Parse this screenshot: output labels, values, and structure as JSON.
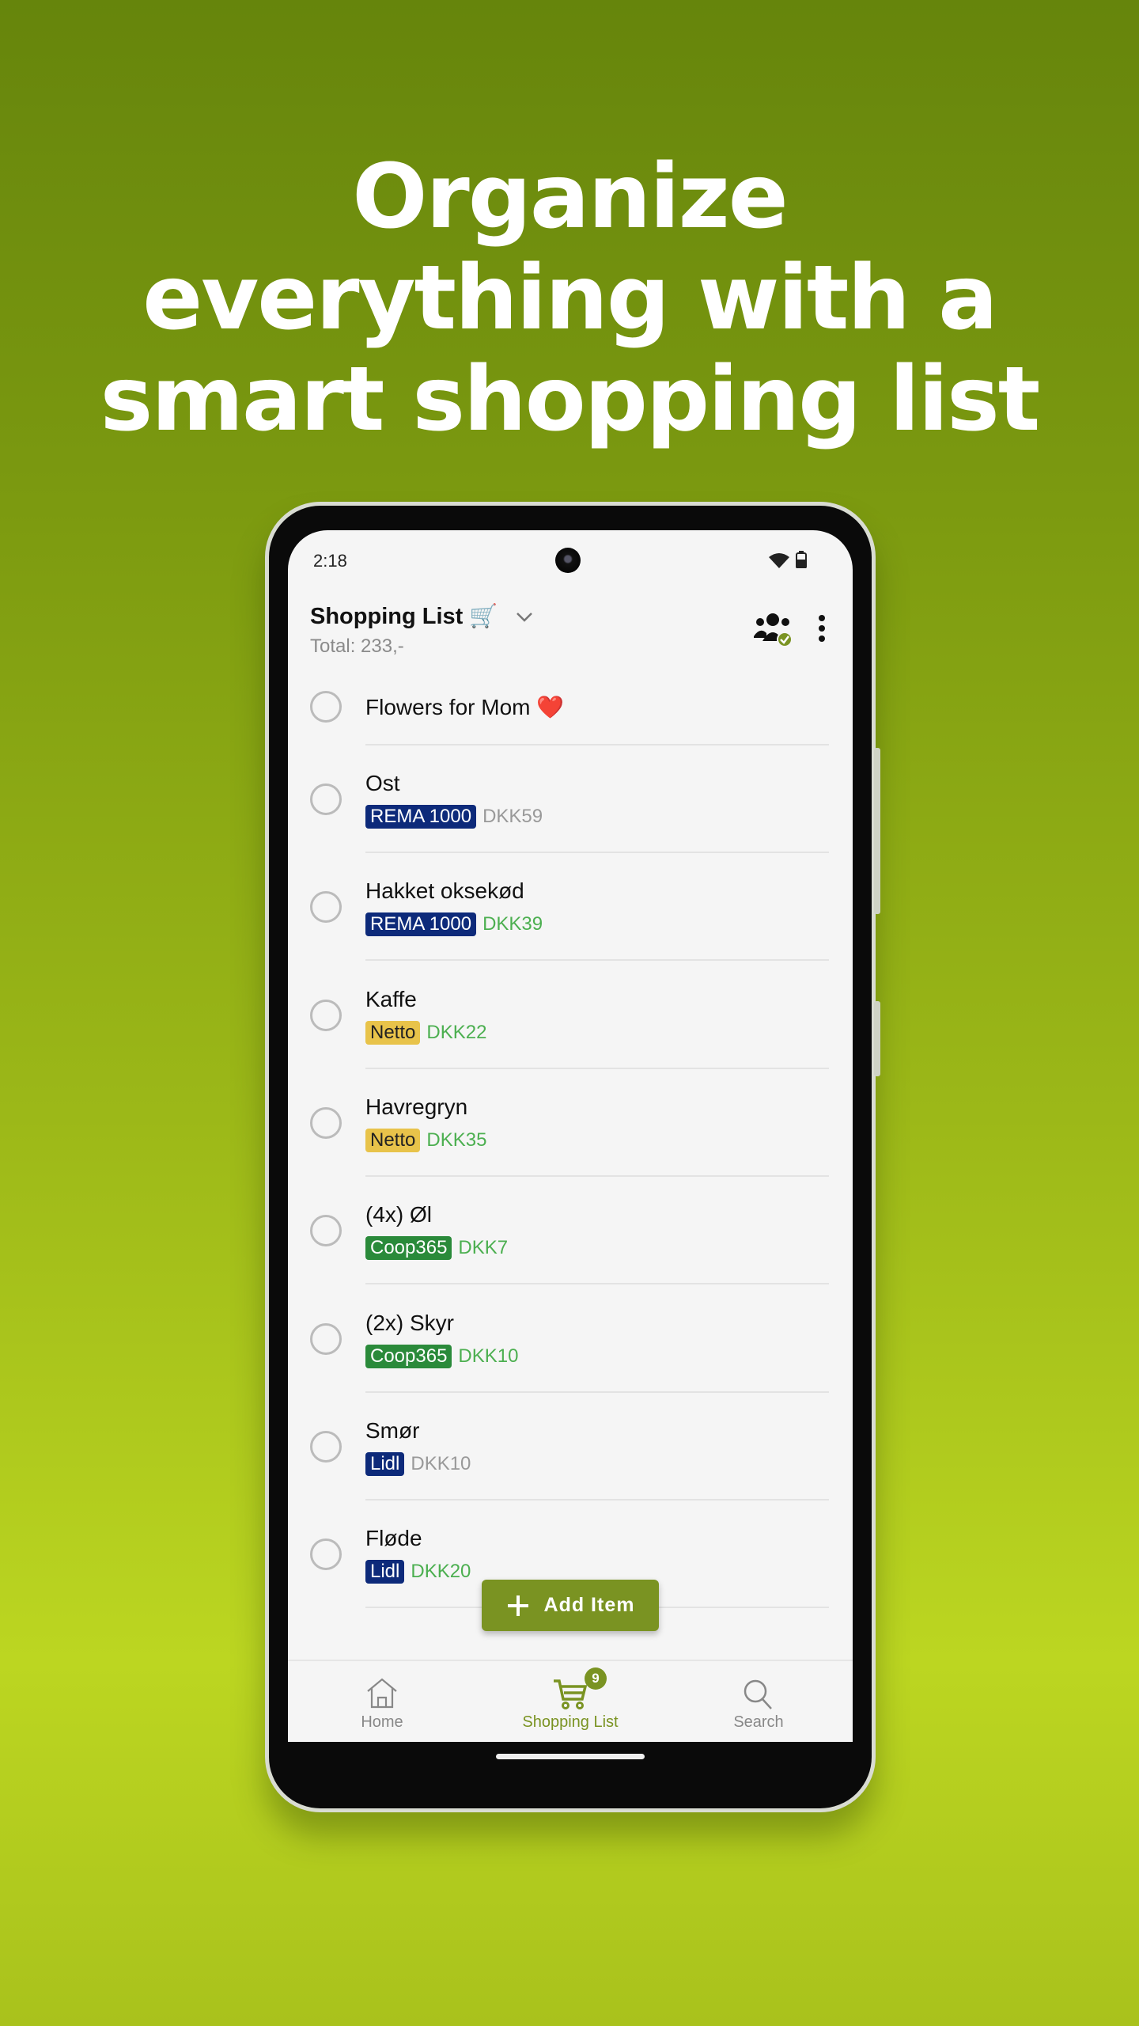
{
  "headline": [
    "Organize",
    "everything with a",
    "smart shopping list"
  ],
  "status": {
    "time": "2:18"
  },
  "header": {
    "title": "Shopping List 🛒",
    "total": "Total: 233,-"
  },
  "colors": {
    "accent": "#7a9322",
    "rema": "#0d2a7a",
    "netto": "#e8c34a",
    "coop": "#2a8a3a",
    "lidl": "#0d2a7a",
    "price_green": "#4caf50",
    "price_grey": "#999999"
  },
  "items": [
    {
      "name": "Flowers for Mom ❤️"
    },
    {
      "name": "Ost",
      "store": "REMA 1000",
      "store_key": "rema",
      "price": "DKK59",
      "price_color": "grey"
    },
    {
      "name": "Hakket oksekød",
      "store": "REMA 1000",
      "store_key": "rema",
      "price": "DKK39",
      "price_color": "green"
    },
    {
      "name": "Kaffe",
      "store": "Netto",
      "store_key": "netto",
      "price": "DKK22",
      "price_color": "green"
    },
    {
      "name": "Havregryn",
      "store": "Netto",
      "store_key": "netto",
      "price": "DKK35",
      "price_color": "green"
    },
    {
      "name": "(4x) Øl",
      "store": "Coop365",
      "store_key": "coop",
      "price": "DKK7",
      "price_color": "green"
    },
    {
      "name": "(2x) Skyr",
      "store": "Coop365",
      "store_key": "coop",
      "price": "DKK10",
      "price_color": "green"
    },
    {
      "name": "Smør",
      "store": "Lidl",
      "store_key": "lidl",
      "price": "DKK10",
      "price_color": "grey"
    },
    {
      "name": "Fløde",
      "store": "Lidl",
      "store_key": "lidl",
      "price": "DKK20",
      "price_color": "green"
    }
  ],
  "add_button": {
    "label": "Add Item"
  },
  "nav": {
    "home": "Home",
    "shopping": "Shopping List",
    "search": "Search",
    "badge": "9"
  }
}
